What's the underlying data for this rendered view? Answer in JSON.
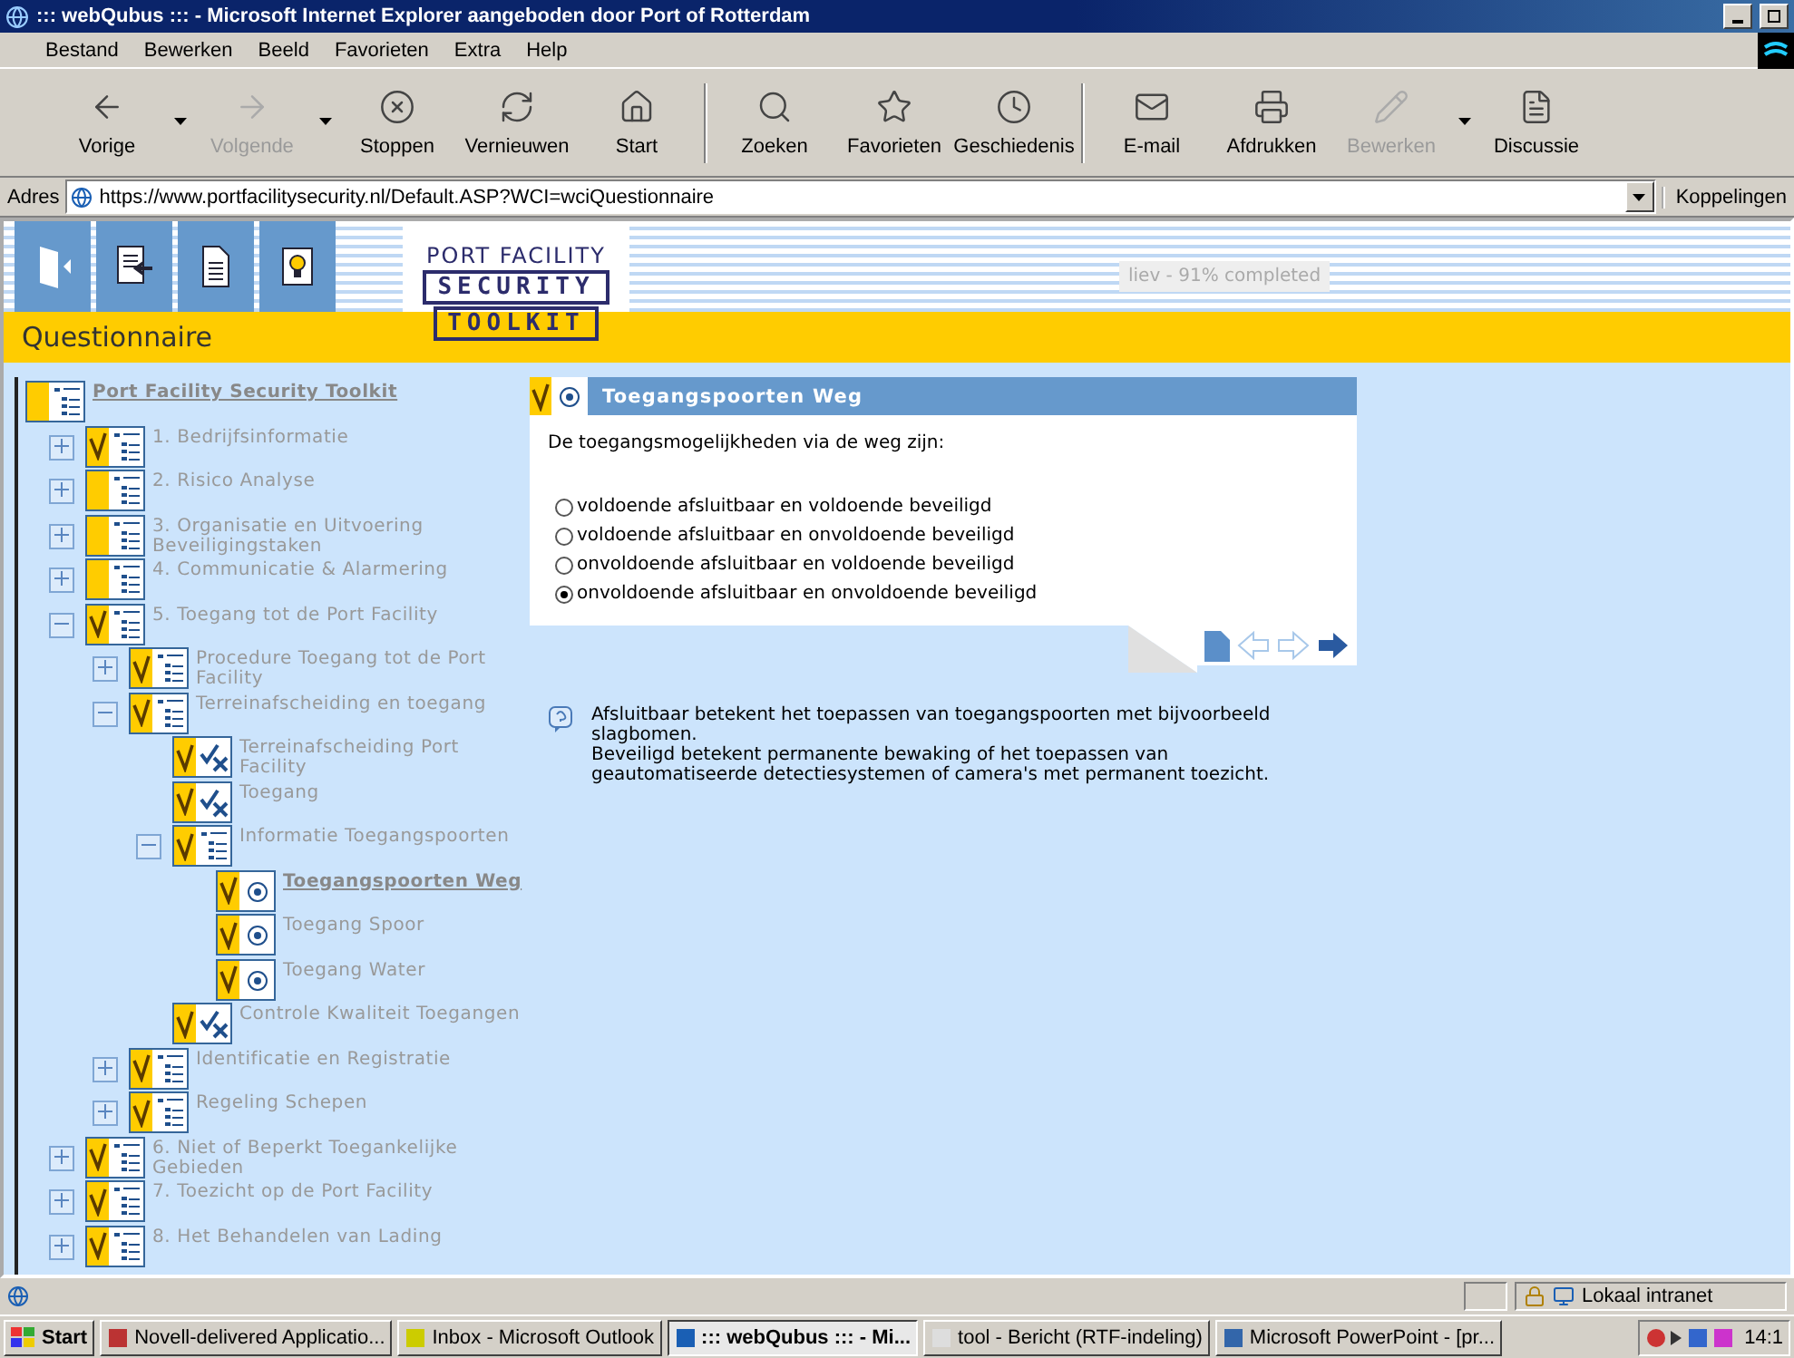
{
  "window": {
    "title": "::: webQubus ::: - Microsoft Internet Explorer aangeboden door Port of Rotterdam"
  },
  "menu": [
    "Bestand",
    "Bewerken",
    "Beeld",
    "Favorieten",
    "Extra",
    "Help"
  ],
  "toolbar": [
    {
      "label": "Vorige",
      "disabled": false,
      "dropdown": true
    },
    {
      "label": "Volgende",
      "disabled": true,
      "dropdown": true
    },
    {
      "label": "Stoppen",
      "disabled": false,
      "dropdown": false
    },
    {
      "label": "Vernieuwen",
      "disabled": false,
      "dropdown": false
    },
    {
      "label": "Start",
      "disabled": false,
      "dropdown": false
    },
    {
      "label": "Zoeken",
      "disabled": false,
      "dropdown": false
    },
    {
      "label": "Favorieten",
      "disabled": false,
      "dropdown": false
    },
    {
      "label": "Geschiedenis",
      "disabled": false,
      "dropdown": false
    },
    {
      "label": "E-mail",
      "disabled": false,
      "dropdown": false
    },
    {
      "label": "Afdrukken",
      "disabled": false,
      "dropdown": false
    },
    {
      "label": "Bewerken",
      "disabled": true,
      "dropdown": true
    },
    {
      "label": "Discussie",
      "disabled": false,
      "dropdown": false
    }
  ],
  "address": {
    "label": "Adres",
    "value": "https://www.portfacilitysecurity.nl/Default.ASP?WCI=wciQuestionnaire",
    "links": "Koppelingen"
  },
  "header": {
    "logo_top": "PORT FACILITY",
    "logo_middle": "SECURITY",
    "logo_bottom": "TOOLKIT",
    "progress": "liev - 91% completed",
    "section": "Questionnaire"
  },
  "tree": {
    "title": "Port Facility Security Toolkit",
    "items": [
      {
        "label": "1. Bedrijfsinformatie",
        "kind": "folder",
        "checked": true,
        "selected": false,
        "expanded": false
      },
      {
        "label": "2. Risico Analyse",
        "kind": "folder",
        "checked": false,
        "selected": false,
        "expanded": false
      },
      {
        "label": "3. Organisatie en Uitvoering Beveiligingstaken",
        "kind": "folder",
        "checked": false,
        "selected": false,
        "expanded": false
      },
      {
        "label": "4. Communicatie & Alarmering",
        "kind": "folder",
        "checked": false,
        "selected": false,
        "expanded": false
      },
      {
        "label": "5. Toegang tot de Port Facility",
        "kind": "folder",
        "checked": true,
        "selected": false,
        "expanded": true,
        "children": [
          {
            "label": "Procedure Toegang tot de Port Facility",
            "kind": "folder",
            "checked": true,
            "selected": false,
            "expanded": false
          },
          {
            "label": "Terreinafscheiding en toegang",
            "kind": "folder",
            "checked": true,
            "selected": false,
            "expanded": true,
            "children": [
              {
                "label": "Terreinafscheiding Port Facility",
                "kind": "checklist",
                "checked": true,
                "selected": false
              },
              {
                "label": "Toegang",
                "kind": "checklist",
                "checked": true,
                "selected": false
              },
              {
                "label": "Informatie Toegangspoorten",
                "kind": "folder",
                "checked": true,
                "selected": false,
                "expanded": true,
                "children": [
                  {
                    "label": "Toegangspoorten Weg",
                    "kind": "radio",
                    "checked": true,
                    "selected": true
                  },
                  {
                    "label": "Toegang Spoor",
                    "kind": "radio",
                    "checked": true,
                    "selected": false
                  },
                  {
                    "label": "Toegang Water",
                    "kind": "radio",
                    "checked": true,
                    "selected": false
                  }
                ]
              },
              {
                "label": "Controle Kwaliteit Toegangen",
                "kind": "checklist",
                "checked": true,
                "selected": false
              }
            ]
          },
          {
            "label": "Identificatie en Registratie",
            "kind": "folder",
            "checked": true,
            "selected": false,
            "expanded": false
          },
          {
            "label": "Regeling Schepen",
            "kind": "folder",
            "checked": true,
            "selected": false,
            "expanded": false
          }
        ]
      },
      {
        "label": "6. Niet of Beperkt Toegankelijke Gebieden",
        "kind": "folder",
        "checked": true,
        "selected": false,
        "expanded": false
      },
      {
        "label": "7. Toezicht op de Port Facility",
        "kind": "folder",
        "checked": true,
        "selected": false,
        "expanded": false
      },
      {
        "label": "8. Het Behandelen van Lading",
        "kind": "folder",
        "checked": true,
        "selected": false,
        "expanded": false
      }
    ]
  },
  "question": {
    "title": "Toegangspoorten Weg",
    "checked": true,
    "text": "De toegangsmogelijkheden via de weg zijn:",
    "options": [
      {
        "label": "voldoende afsluitbaar en voldoende beveiligd",
        "selected": false
      },
      {
        "label": "voldoende afsluitbaar en onvoldoende beveiligd",
        "selected": false
      },
      {
        "label": "onvoldoende afsluitbaar en voldoende beveiligd",
        "selected": false
      },
      {
        "label": "onvoldoende afsluitbaar en onvoldoende beveiligd",
        "selected": true
      }
    ]
  },
  "help": [
    "Afsluitbaar betekent het toepassen van toegangspoorten met bijvoorbeeld slagbomen.",
    "Beveiligd betekent permanente bewaking of het toepassen van geautomatiseerde detectiesystemen of camera's met permanent toezicht."
  ],
  "status_bar": {
    "zone": "Lokaal intranet"
  },
  "taskbar": {
    "start": "Start",
    "items": [
      {
        "label": "Novell-delivered Applicatio...",
        "selected": false
      },
      {
        "label": "Inbox - Microsoft Outlook",
        "selected": false
      },
      {
        "label": "::: webQubus ::: - Mi...",
        "selected": true
      },
      {
        "label": "tool - Bericht (RTF-indeling)",
        "selected": false
      },
      {
        "label": "Microsoft PowerPoint - [pr...",
        "selected": false
      }
    ],
    "clock": "14:1"
  }
}
